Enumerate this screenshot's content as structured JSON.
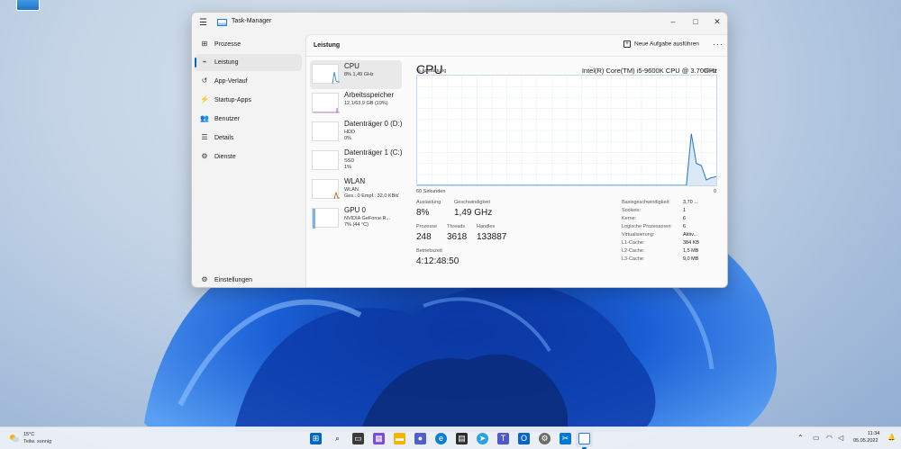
{
  "window": {
    "title": "Task-Manager",
    "controls": {
      "minimize": "–",
      "maximize": "□",
      "close": "✕"
    }
  },
  "sidebar": {
    "items": [
      {
        "label": "Prozesse",
        "icon": "grid-icon"
      },
      {
        "label": "Leistung",
        "icon": "performance-icon"
      },
      {
        "label": "App-Verlauf",
        "icon": "history-icon"
      },
      {
        "label": "Startup-Apps",
        "icon": "startup-icon"
      },
      {
        "label": "Benutzer",
        "icon": "users-icon"
      },
      {
        "label": "Details",
        "icon": "details-icon"
      },
      {
        "label": "Dienste",
        "icon": "services-icon"
      }
    ],
    "settings_label": "Einstellungen"
  },
  "header": {
    "title": "Leistung",
    "run_task_label": "Neue Aufgabe ausführen",
    "more_label": "···"
  },
  "devices": [
    {
      "name": "CPU",
      "sub1": "8% 1,49 GHz",
      "sub2": ""
    },
    {
      "name": "Arbeitsspeicher",
      "sub1": "12,1/63,9 GB (19%)",
      "sub2": ""
    },
    {
      "name": "Datenträger 0 (D:)",
      "sub1": "HDD",
      "sub2": "0%"
    },
    {
      "name": "Datenträger 1 (C:)",
      "sub1": "SSD",
      "sub2": "1%"
    },
    {
      "name": "WLAN",
      "sub1": "WLAN",
      "sub2": "Ges.: 0 Empf.: 32,0 KBit/"
    },
    {
      "name": "GPU 0",
      "sub1": "NVIDIA GeForce R...",
      "sub2": "7% (44 °C)"
    }
  ],
  "detail": {
    "title": "CPU",
    "model": "Intel(R) Core(TM) i5-9600K CPU @ 3.70GHz",
    "y_label": "% Auslastung",
    "y_max": "100%",
    "x_label": "60 Sekunden",
    "x_min": "0",
    "stats": {
      "auslastung_label": "Auslastung",
      "auslastung_value": "8%",
      "geschwindigkeit_label": "Geschwindigkeit",
      "geschwindigkeit_value": "1,49 GHz",
      "prozesse_label": "Prozesse",
      "prozesse_value": "248",
      "threads_label": "Threads",
      "threads_value": "3618",
      "handles_label": "Handles",
      "handles_value": "133887",
      "betriebszeit_label": "Betriebszeit",
      "betriebszeit_value": "4:12:48:50"
    },
    "specs": [
      {
        "k": "Basisgeschwindigkeit:",
        "v": "3,70 ..."
      },
      {
        "k": "Sockets:",
        "v": "1"
      },
      {
        "k": "Kerne:",
        "v": "6"
      },
      {
        "k": "Logische Prozessoren:",
        "v": "6"
      },
      {
        "k": "Virtualisierung:",
        "v": "Aktiv..."
      },
      {
        "k": "L1-Cache:",
        "v": "384 KB"
      },
      {
        "k": "L2-Cache:",
        "v": "1,5 MB"
      },
      {
        "k": "L3-Cache:",
        "v": "9,0 MB"
      }
    ],
    "cpu_history": [
      0,
      0,
      0,
      0,
      0,
      0,
      0,
      0,
      0,
      0,
      0,
      0,
      0,
      0,
      0,
      0,
      0,
      0,
      0,
      0,
      0,
      0,
      0,
      0,
      0,
      0,
      0,
      0,
      0,
      0,
      0,
      0,
      0,
      0,
      0,
      0,
      0,
      0,
      0,
      0,
      0,
      0,
      0,
      0,
      0,
      0,
      0,
      0,
      0,
      0,
      0,
      0,
      0,
      0,
      0,
      47,
      20,
      18,
      5,
      7,
      8
    ]
  },
  "taskbar": {
    "weather_temp": "15°C",
    "weather_desc": "Teilw. sonnig",
    "time": "11:34",
    "date": "05.05.2022",
    "apps": [
      "start-icon",
      "search-icon",
      "task-view-icon",
      "widgets-icon",
      "chat-icon",
      "file-explorer-icon",
      "store-icon",
      "edge-icon",
      "terminal-icon",
      "telegram-icon",
      "teams-icon",
      "outlook-icon",
      "settings-icon",
      "snipping-icon",
      "task-manager-icon"
    ]
  },
  "colors": {
    "accent": "#0067c0",
    "graph_line": "#1f78c4",
    "graph_fill": "#dbe9f6"
  }
}
